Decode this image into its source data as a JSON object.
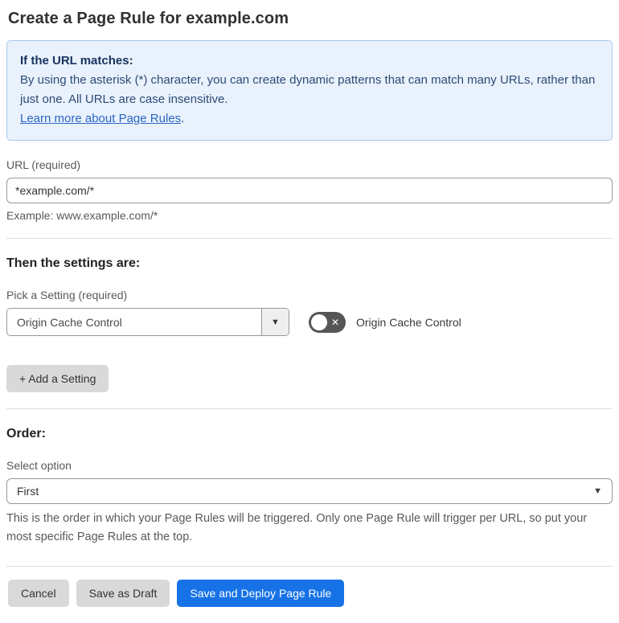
{
  "page": {
    "title": "Create a Page Rule for example.com"
  },
  "info_box": {
    "heading": "If the URL matches:",
    "body": "By using the asterisk (*) character, you can create dynamic patterns that can match many URLs, rather than just one. All URLs are case insensitive.",
    "link_label": "Learn more about Page Rules",
    "link_suffix": "."
  },
  "url_field": {
    "label": "URL (required)",
    "value": "*example.com/*",
    "helper": "Example: www.example.com/*"
  },
  "settings_section": {
    "heading": "Then the settings are:",
    "picker_label": "Pick a Setting (required)",
    "picker_value": "Origin Cache Control",
    "picker_arrow_icon": "▼",
    "toggle_state": "off",
    "toggle_x_icon": "✕",
    "toggle_label": "Origin Cache Control",
    "add_setting_label": "+ Add a Setting"
  },
  "order_section": {
    "heading": "Order:",
    "select_label": "Select option",
    "select_value": "First",
    "select_caret_icon": "▼",
    "helper": "This is the order in which your Page Rules will be triggered. Only one Page Rule will trigger per URL, so put your most specific Page Rules at the top."
  },
  "footer": {
    "cancel_label": "Cancel",
    "save_draft_label": "Save as Draft",
    "save_deploy_label": "Save and Deploy Page Rule"
  },
  "colors": {
    "primary_blue": "#1672e6",
    "info_background": "#e9f2fc",
    "info_border": "#a9c7ea",
    "info_heading_text": "#16325e",
    "info_body_text": "#2d4a77",
    "link_blue": "#2c66c6",
    "toggle_off_gray": "#565656",
    "button_gray": "#d9d9d9"
  }
}
